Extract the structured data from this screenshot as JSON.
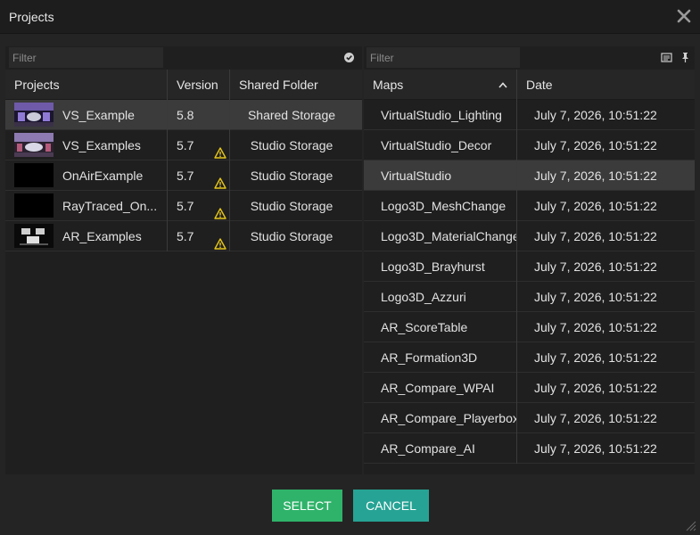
{
  "window": {
    "title": "Projects"
  },
  "left": {
    "filter_placeholder": "Filter",
    "columns": {
      "projects": "Projects",
      "version": "Version",
      "shared_folder": "Shared Folder"
    },
    "rows": [
      {
        "name": "VS_Example",
        "version": "5.8",
        "folder": "Shared Storage",
        "warning": false,
        "selected": true
      },
      {
        "name": "VS_Examples",
        "version": "5.7",
        "folder": "Studio Storage",
        "warning": true,
        "selected": false
      },
      {
        "name": "OnAirExample",
        "version": "5.7",
        "folder": "Studio Storage",
        "warning": true,
        "selected": false
      },
      {
        "name": "RayTraced_On...",
        "version": "5.7",
        "folder": "Studio Storage",
        "warning": true,
        "selected": false
      },
      {
        "name": "AR_Examples",
        "version": "5.7",
        "folder": "Studio Storage",
        "warning": true,
        "selected": false
      }
    ]
  },
  "right": {
    "filter_placeholder": "Filter",
    "columns": {
      "maps": "Maps",
      "date": "Date"
    },
    "rows": [
      {
        "map": "VirtualStudio_Lighting",
        "date": "July 7, 2026, 10:51:22"
      },
      {
        "map": "VirtualStudio_Decor",
        "date": "July 7, 2026, 10:51:22"
      },
      {
        "map": "VirtualStudio",
        "date": "July 7, 2026, 10:51:22",
        "selected": true
      },
      {
        "map": "Logo3D_MeshChange",
        "date": "July 7, 2026, 10:51:22"
      },
      {
        "map": "Logo3D_MaterialChange",
        "date": "July 7, 2026, 10:51:22"
      },
      {
        "map": "Logo3D_Brayhurst",
        "date": "July 7, 2026, 10:51:22"
      },
      {
        "map": "Logo3D_Azzuri",
        "date": "July 7, 2026, 10:51:22"
      },
      {
        "map": "AR_ScoreTable",
        "date": "July 7, 2026, 10:51:22"
      },
      {
        "map": "AR_Formation3D",
        "date": "July 7, 2026, 10:51:22"
      },
      {
        "map": "AR_Compare_WPAI",
        "date": "July 7, 2026, 10:51:22"
      },
      {
        "map": "AR_Compare_Playerbox",
        "date": "July 7, 2026, 10:51:22"
      },
      {
        "map": "AR_Compare_AI",
        "date": "July 7, 2026, 10:51:22"
      }
    ]
  },
  "buttons": {
    "select": "SELECT",
    "cancel": "CANCEL"
  },
  "colors": {
    "select": "#2fb36a",
    "cancel": "#26a394",
    "warning": "#e6c619"
  }
}
